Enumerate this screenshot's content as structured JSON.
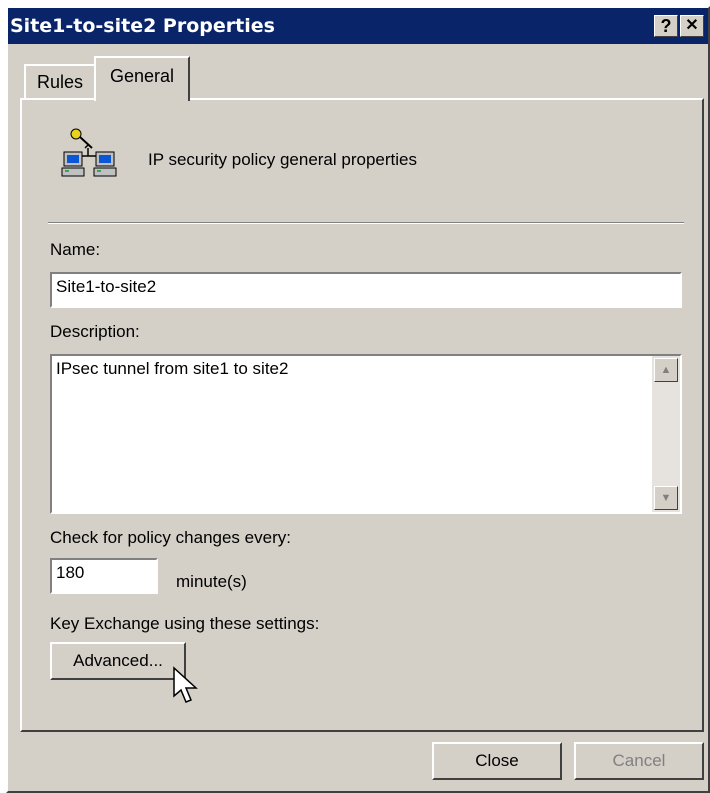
{
  "window": {
    "title": "Site1-to-site2 Properties",
    "help_glyph": "?",
    "close_glyph": "✕"
  },
  "tabs": [
    {
      "label": "Rules",
      "active": false
    },
    {
      "label": "General",
      "active": true
    }
  ],
  "general": {
    "header_text": "IP security policy general properties",
    "name_label": "Name:",
    "name_value": "Site1-to-site2",
    "description_label": "Description:",
    "description_value": "IPsec tunnel from site1 to site2",
    "check_label": "Check for policy changes every:",
    "check_value": "180",
    "check_unit": "minute(s)",
    "key_exchange_label": "Key Exchange using these settings:",
    "advanced_button": "Advanced..."
  },
  "footer": {
    "close_button": "Close",
    "cancel_button": "Cancel"
  },
  "colors": {
    "titlebar": "#0a246a",
    "face": "#d4d0c8",
    "disabled_text": "#808080"
  }
}
